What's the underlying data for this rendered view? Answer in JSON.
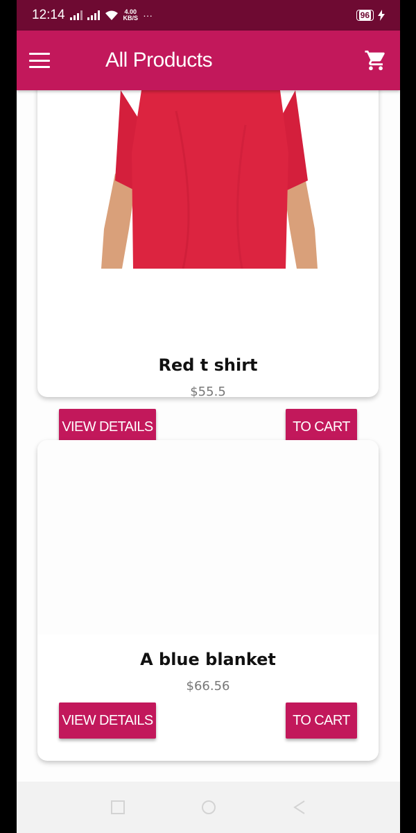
{
  "status_bar": {
    "time": "12:14",
    "net_speed_value": "4.00",
    "net_speed_unit": "KB/S",
    "more": "···",
    "battery": "96",
    "icons": [
      "signal-icon",
      "signal-icon",
      "wifi-icon",
      "battery-icon",
      "charging-icon"
    ]
  },
  "app_bar": {
    "title": "All Products",
    "menu_icon": "hamburger-menu-icon",
    "cart_icon": "shopping-cart-icon"
  },
  "products": [
    {
      "name": "Red t shirt",
      "price": "$55.5",
      "details_label": "VIEW DETAILS",
      "cart_label": "TO CART",
      "image": "red-tshirt-image"
    },
    {
      "name": "A blue blanket",
      "price": "$66.56",
      "details_label": "VIEW DETAILS",
      "cart_label": "TO CART",
      "image": "blank-image"
    }
  ],
  "nav_bar": {
    "icons": [
      "recent-apps-icon",
      "home-icon",
      "back-icon"
    ]
  },
  "colors": {
    "primary": "#c2185b",
    "primary_dark": "#6e0a32",
    "background": "#fdfdfd",
    "tshirt": "#d81f3a"
  }
}
